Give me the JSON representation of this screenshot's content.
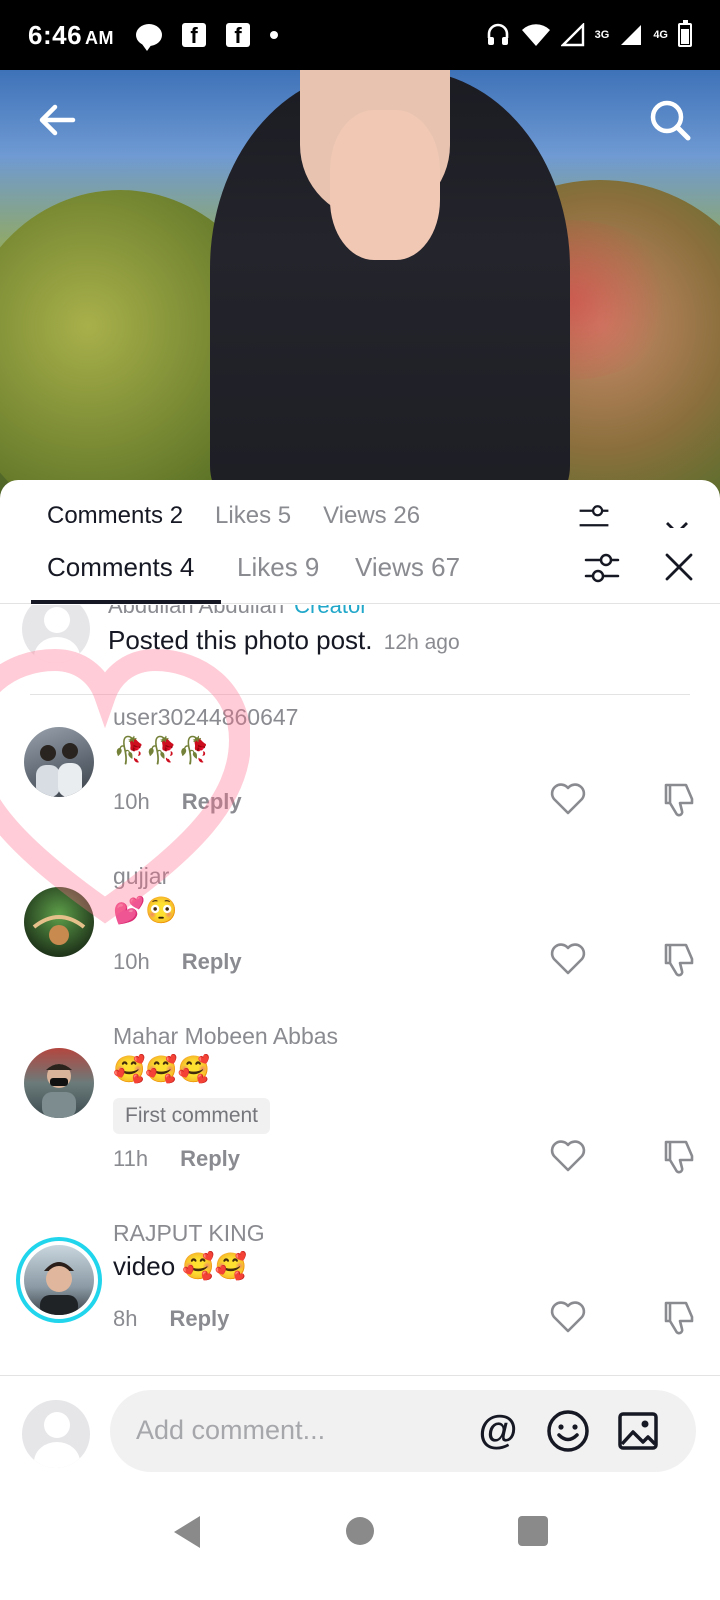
{
  "status_bar": {
    "time": "6:46",
    "ampm": "AM",
    "net1": "3G",
    "net2": "4G",
    "fb_letter": "f"
  },
  "ghost_tabs": {
    "comments": "Comments 2",
    "likes": "Likes 5",
    "views": "Views 26"
  },
  "tabs": {
    "comments": "Comments 4",
    "likes": "Likes 9",
    "views": "Views 67"
  },
  "post_header": {
    "author": "Abdullah Abdullah",
    "creator_tag": "Creator",
    "text": "Posted this photo post.",
    "time": "12h ago"
  },
  "comments": [
    {
      "username": "user30244860647",
      "text": "🥀🥀🥀",
      "time": "10h",
      "reply": "Reply",
      "badge": ""
    },
    {
      "username": "gujjar",
      "text": "💕😳",
      "time": "10h",
      "reply": "Reply",
      "badge": ""
    },
    {
      "username": "Mahar Mobeen Abbas",
      "text": "🥰🥰🥰",
      "time": "11h",
      "reply": "Reply",
      "badge": "First comment"
    },
    {
      "username": "RAJPUT KING",
      "text": "video 🥰🥰",
      "time": "8h",
      "reply": "Reply",
      "badge": ""
    }
  ],
  "input": {
    "placeholder": "Add comment...",
    "at_symbol": "@"
  },
  "colors": {
    "creator": "#20a7c9",
    "accent_ring": "#20d5ec",
    "text_primary": "#161823",
    "text_secondary": "#8a8b91"
  }
}
